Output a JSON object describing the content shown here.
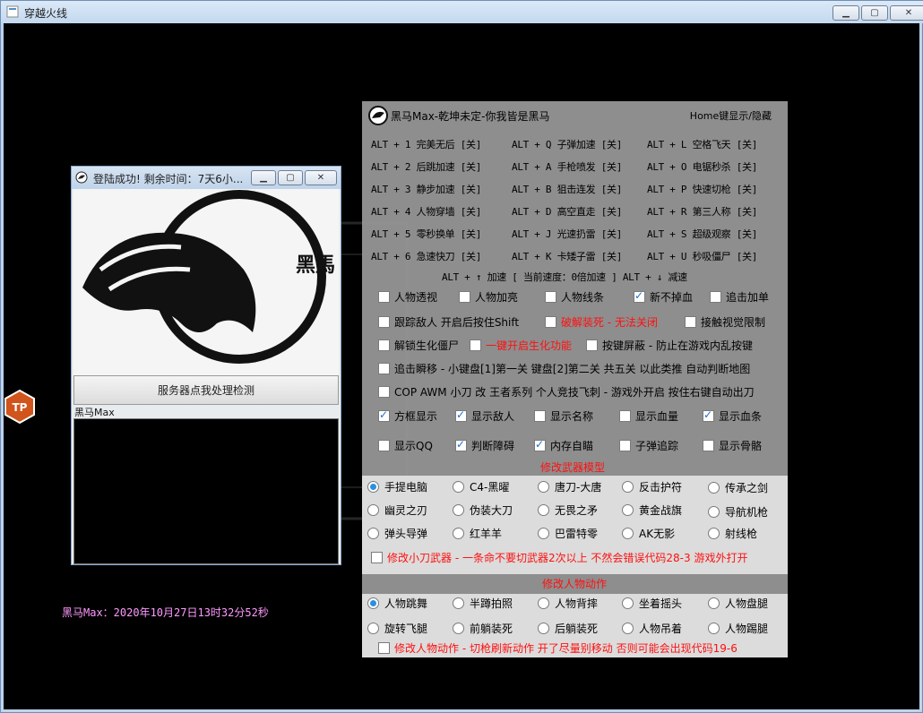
{
  "window": {
    "title": "穿越火线"
  },
  "login": {
    "title": "登陆成功! 剩余时间：7天6小...",
    "logo_text": "黑馬",
    "check_button": "服务器点我处理检测",
    "log_label": "黑马Max"
  },
  "status_line": "黑马Max：2020年10月27日13时32分52秒",
  "tp_badge": "TP",
  "panel": {
    "title": "黑马Max-乾坤未定-你我皆是黑马",
    "hint": "Home键显示/隐藏",
    "hotkeys": [
      [
        "ALT + 1 完美无后 [关]",
        "ALT + Q 子弹加速 [关]",
        "ALT + L 空格飞天  [关]"
      ],
      [
        "ALT + 2 后跳加速 [关]",
        "ALT + A 手枪喷发 [关]",
        "ALT + O 电锯秒杀  [关]"
      ],
      [
        "ALT + 3 静步加速 [关]",
        "ALT + B 狙击连发 [关]",
        "ALT + P 快速切枪  [关]"
      ],
      [
        "ALT + 4 人物穿墙 [关]",
        "ALT + D 高空直走 [关]",
        "ALT + R 第三人称  [关]"
      ],
      [
        "ALT + 5 零秒换单 [关]",
        "ALT + J 光速扔雷 [关]",
        "ALT + S 超级观察  [关]"
      ],
      [
        "ALT + 6 急速快刀 [关]",
        "ALT + K 卡矮子雷 [关]",
        "ALT + U 秒吸僵尸  [关]"
      ]
    ],
    "speed_line": "ALT + ↑ 加速 [ 当前速度：0倍加速 ] ALT + ↓ 减速",
    "opts": {
      "o1": "人物透视",
      "o2": "人物加亮",
      "o3": "人物线条",
      "o4": "新不掉血",
      "o5": "追击加单",
      "o6": "跟踪敌人 开启后按住Shift",
      "o7": "破解装死 - 无法关闭",
      "o8": "接触视觉限制",
      "o9": "解锁生化僵尸",
      "o10": "一键开启生化功能",
      "o11": "按键屏蔽  -  防止在游戏内乱按键",
      "o12": "追击瞬移 - 小键盘[1]第一关 键盘[2]第二关 共五关 以此类推 自动判断地图",
      "o13": "COP AWM 小刀 改 王者系列  个人竞技飞刺 - 游戏外开启 按住右键自动出刀",
      "o14": "方框显示",
      "o15": "显示敌人",
      "o16": "显示名称",
      "o17": "显示血量",
      "o18": "显示血条",
      "o19": "显示QQ",
      "o20": "判断障碍",
      "o21": "内存自瞄",
      "o22": "子弹追踪",
      "o23": "显示骨骼"
    },
    "weapon_title": "修改武器模型",
    "weapons": [
      [
        "手提电脑",
        "C4-黑曜",
        "唐刀-大唐",
        "反击护符",
        "传承之剑"
      ],
      [
        "幽灵之刃",
        "伪装大刀",
        "无畏之矛",
        "黄金战旗",
        "导航机枪"
      ],
      [
        "弹头导弹",
        "红羊羊",
        "巴雷特零",
        "AK无影",
        "射线枪"
      ]
    ],
    "weapon_note": "修改小刀武器 - 一条命不要切武器2次以上 不然会错误代码28-3 游戏外打开",
    "action_title": "修改人物动作",
    "actions": [
      [
        "人物跳舞",
        "半蹲拍照",
        "人物背摔",
        "坐着摇头",
        "人物盘腿"
      ],
      [
        "旋转飞腿",
        "前躺装死",
        "后躺装死",
        "人物吊着",
        "人物踢腿"
      ]
    ],
    "action_note": "修改人物动作 - 切枪刷新动作 开了尽量别移动 否则可能会出现代码19-6"
  },
  "colors": {
    "accent": "#2b8fe0",
    "warning": "#ff1010",
    "status": "#ff9aff"
  }
}
